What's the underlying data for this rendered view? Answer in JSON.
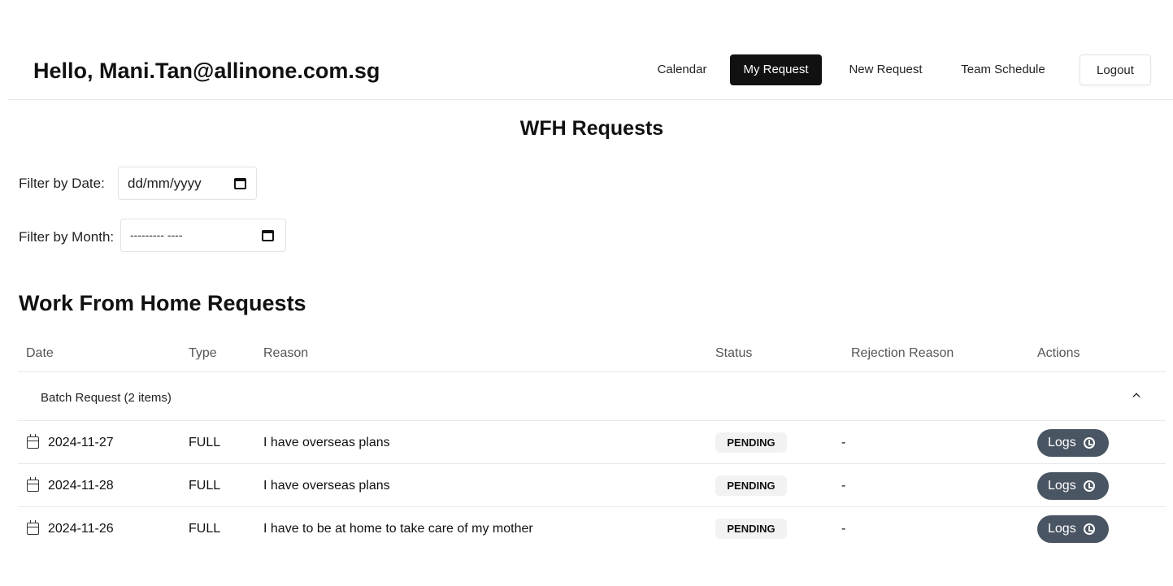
{
  "header": {
    "greeting": "Hello, Mani.Tan@allinone.com.sg",
    "nav": {
      "calendar": "Calendar",
      "my_request": "My Request",
      "new_request": "New Request",
      "team_schedule": "Team Schedule",
      "logout": "Logout"
    }
  },
  "page_title": "WFH Requests",
  "filters": {
    "date_label": "Filter by Date:",
    "date_value": "dd/mm/yyyy",
    "month_label": "Filter by Month:",
    "month_value": "--------- ----"
  },
  "section_title": "Work From Home Requests",
  "table": {
    "headers": [
      "Date",
      "Type",
      "Reason",
      "Status",
      "Rejection Reason",
      "Actions"
    ],
    "batch_label": "Batch Request (2 items)",
    "rows": [
      {
        "date": "2024-11-27",
        "type": "FULL",
        "reason": "I have overseas plans",
        "status": "PENDING",
        "rejection": "-",
        "action": "Logs"
      },
      {
        "date": "2024-11-28",
        "type": "FULL",
        "reason": "I have overseas plans",
        "status": "PENDING",
        "rejection": "-",
        "action": "Logs"
      },
      {
        "date": "2024-11-26",
        "type": "FULL",
        "reason": "I have to be at home to take care of my mother",
        "status": "PENDING",
        "rejection": "-",
        "action": "Logs"
      }
    ]
  },
  "icons": {
    "date_picker": "calendar-icon",
    "row_date": "calendar-icon",
    "batch_toggle": "chevron-up-icon",
    "logs": "history-icon"
  },
  "colors": {
    "active_nav": "#111111",
    "logs_button": "#4a5563",
    "status_badge": "#f2f2f2"
  }
}
